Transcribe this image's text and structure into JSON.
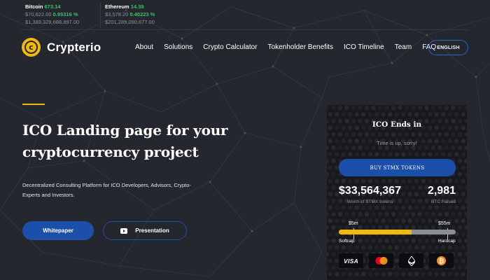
{
  "ticker": [
    {
      "name": "Bitcoin",
      "price": "673.14",
      "line2_value": "$70,622.00",
      "line2_change": "0.95316 %",
      "line3": "$1,389,329,688,897.00"
    },
    {
      "name": "Ethereum",
      "price": "14.39",
      "line2_value": "$3,578.20",
      "line2_change": "0.40223 %",
      "line3": "$201,289,090,677.00"
    }
  ],
  "brand": {
    "name": "Crypterio",
    "logo_glyph": "c",
    "accent_color": "#f0b90b",
    "primary_color": "#1c4faa"
  },
  "nav": {
    "items": [
      "About",
      "Solutions",
      "Crypto Calculator",
      "Tokenholder Benefits",
      "ICO Timeline",
      "Team",
      "FAQ"
    ],
    "language_button": "ENGLISH"
  },
  "hero": {
    "title_line1": "ICO Landing page for your",
    "title_line2": "cryptocurrency project",
    "subtitle": "Decentralized Consulting Platform for ICO Developers, Advisors, Crypto-Experts and Investors.",
    "primary_button": "Whitepaper",
    "secondary_button": "Presentation",
    "secondary_icon": "video-play-icon"
  },
  "ico_card": {
    "title": "ICO Ends in",
    "status": "Time is up, sorry!",
    "buy_button": "BUY STMX TOKENS",
    "tokens_value": "$33,564,367",
    "tokens_label": "Worth of STMX tokens",
    "btc_value": "2,981",
    "btc_label": "BTC Raised",
    "softcap_marker": "$5m",
    "hardcap_marker": "$55m",
    "softcap_label": "Softcap",
    "hardcap_label": "Hardcap",
    "progress_fraction": 0.62,
    "payment_methods": [
      {
        "label": "VISA",
        "icon": "visa-icon"
      },
      {
        "label": "",
        "icon": "mastercard-icon"
      },
      {
        "label": "",
        "icon": "ethereum-icon"
      },
      {
        "label": "",
        "icon": "bitcoin-icon"
      }
    ]
  }
}
